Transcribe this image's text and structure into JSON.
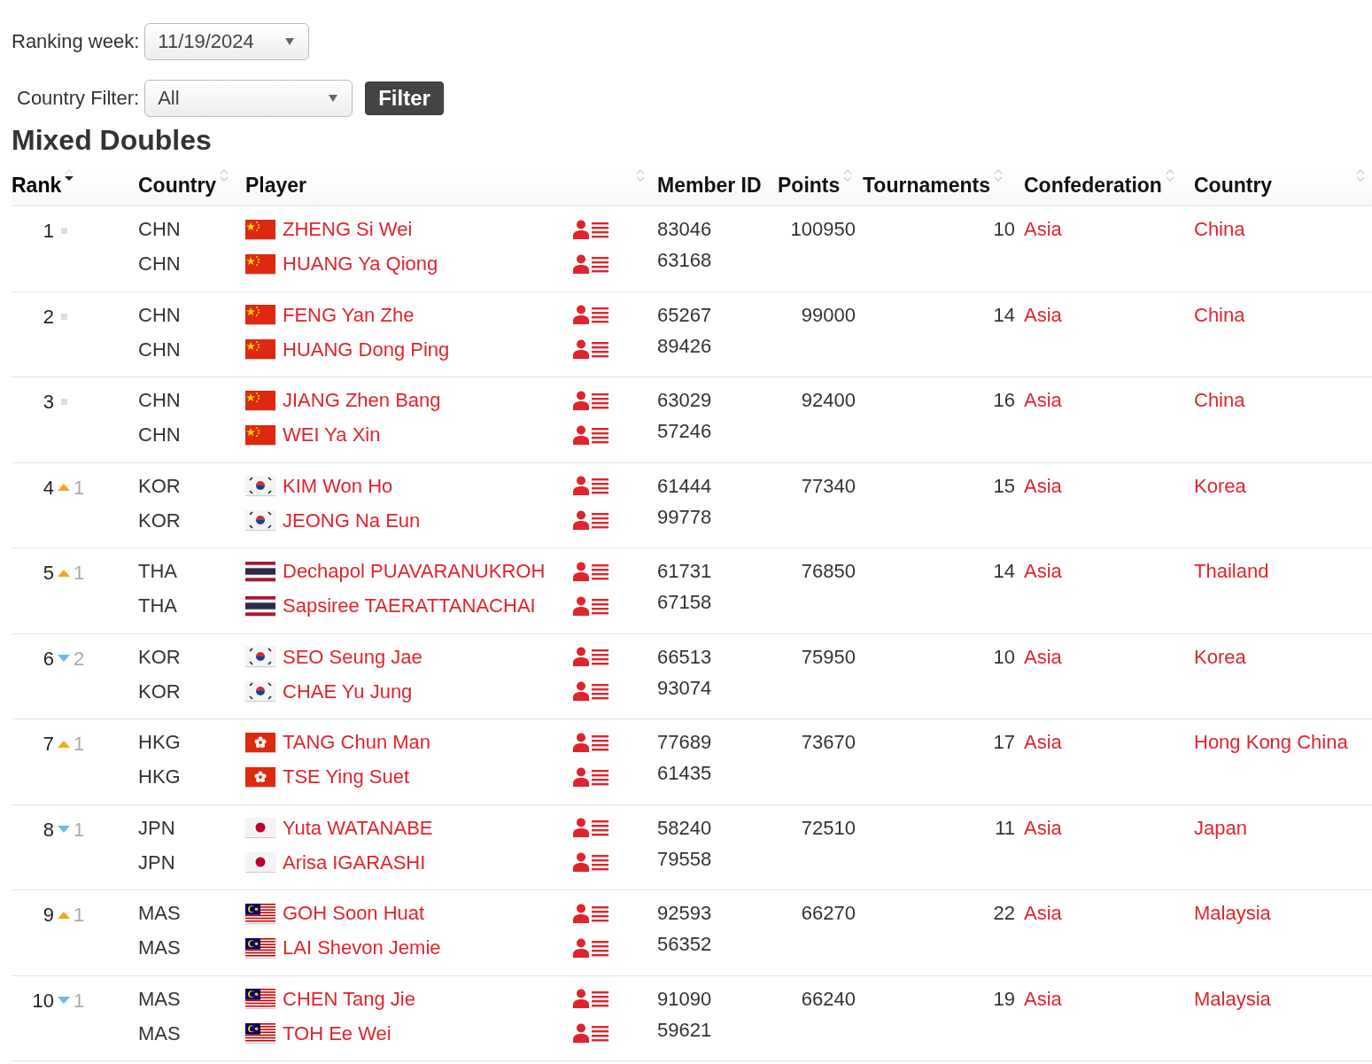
{
  "ranking_week": {
    "label": "Ranking week:",
    "value": "11/19/2024"
  },
  "country_filter": {
    "label": "Country Filter:",
    "value": "All"
  },
  "filter_button": "Filter",
  "heading": "Mixed Doubles",
  "table": {
    "columns": [
      {
        "label": "Rank",
        "sortable": true,
        "sorted": true,
        "kind": "rank"
      },
      {
        "label": "Country",
        "sortable": true,
        "sorted": false,
        "kind": "code"
      },
      {
        "label": "Player",
        "sortable": true,
        "sorted": false,
        "kind": "player"
      },
      {
        "label": "Member ID",
        "sortable": false,
        "sorted": false,
        "kind": "id"
      },
      {
        "label": "Points",
        "sortable": true,
        "sorted": false,
        "kind": "points"
      },
      {
        "label": "Tournaments",
        "sortable": true,
        "sorted": false,
        "kind": "tournaments"
      },
      {
        "label": "Confederation",
        "sortable": true,
        "sorted": false,
        "kind": "confederation"
      },
      {
        "label": "Country",
        "sortable": true,
        "sorted": false,
        "kind": "country"
      }
    ],
    "rows": [
      {
        "rank": "1",
        "kind": "same",
        "players": [
          {
            "code": "CHN",
            "kind": "cn",
            "name": "ZHENG Si Wei",
            "member_id": "83046"
          },
          {
            "code": "CHN",
            "kind": "cn",
            "name": "HUANG Ya Qiong",
            "member_id": "63168"
          }
        ],
        "points": "100950",
        "tournaments": "10",
        "confederation": "Asia",
        "country": "China"
      },
      {
        "rank": "2",
        "kind": "same",
        "players": [
          {
            "code": "CHN",
            "kind": "cn",
            "name": "FENG Yan Zhe",
            "member_id": "65267"
          },
          {
            "code": "CHN",
            "kind": "cn",
            "name": "HUANG Dong Ping",
            "member_id": "89426"
          }
        ],
        "points": "99000",
        "tournaments": "14",
        "confederation": "Asia",
        "country": "China"
      },
      {
        "rank": "3",
        "kind": "same",
        "players": [
          {
            "code": "CHN",
            "kind": "cn",
            "name": "JIANG Zhen Bang",
            "member_id": "63029"
          },
          {
            "code": "CHN",
            "kind": "cn",
            "name": "WEI Ya Xin",
            "member_id": "57246"
          }
        ],
        "points": "92400",
        "tournaments": "16",
        "confederation": "Asia",
        "country": "China"
      },
      {
        "rank": "4",
        "kind": "up",
        "change": "1",
        "players": [
          {
            "code": "KOR",
            "kind": "kr",
            "name": "KIM Won Ho",
            "member_id": "61444"
          },
          {
            "code": "KOR",
            "kind": "kr",
            "name": "JEONG Na Eun",
            "member_id": "99778"
          }
        ],
        "points": "77340",
        "tournaments": "15",
        "confederation": "Asia",
        "country": "Korea"
      },
      {
        "rank": "5",
        "kind": "up",
        "change": "1",
        "players": [
          {
            "code": "THA",
            "kind": "th",
            "name": "Dechapol PUAVARANUKROH",
            "member_id": "61731"
          },
          {
            "code": "THA",
            "kind": "th",
            "name": "Sapsiree TAERATTANACHAI",
            "member_id": "67158"
          }
        ],
        "points": "76850",
        "tournaments": "14",
        "confederation": "Asia",
        "country": "Thailand"
      },
      {
        "rank": "6",
        "kind": "down",
        "change": "2",
        "players": [
          {
            "code": "KOR",
            "kind": "kr",
            "name": "SEO Seung Jae",
            "member_id": "66513"
          },
          {
            "code": "KOR",
            "kind": "kr",
            "name": "CHAE Yu Jung",
            "member_id": "93074"
          }
        ],
        "points": "75950",
        "tournaments": "10",
        "confederation": "Asia",
        "country": "Korea"
      },
      {
        "rank": "7",
        "kind": "up",
        "change": "1",
        "players": [
          {
            "code": "HKG",
            "kind": "hk",
            "name": "TANG Chun Man",
            "member_id": "77689"
          },
          {
            "code": "HKG",
            "kind": "hk",
            "name": "TSE Ying Suet",
            "member_id": "61435"
          }
        ],
        "points": "73670",
        "tournaments": "17",
        "confederation": "Asia",
        "country": "Hong Kong China"
      },
      {
        "rank": "8",
        "kind": "down",
        "change": "1",
        "players": [
          {
            "code": "JPN",
            "kind": "jp",
            "name": "Yuta WATANABE",
            "member_id": "58240"
          },
          {
            "code": "JPN",
            "kind": "jp",
            "name": "Arisa IGARASHI",
            "member_id": "79558"
          }
        ],
        "points": "72510",
        "tournaments": "11",
        "confederation": "Asia",
        "country": "Japan"
      },
      {
        "rank": "9",
        "kind": "up",
        "change": "1",
        "players": [
          {
            "code": "MAS",
            "kind": "my",
            "name": "GOH Soon Huat",
            "member_id": "92593"
          },
          {
            "code": "MAS",
            "kind": "my",
            "name": "LAI Shevon Jemie",
            "member_id": "56352"
          }
        ],
        "points": "66270",
        "tournaments": "22",
        "confederation": "Asia",
        "country": "Malaysia"
      },
      {
        "rank": "10",
        "kind": "down",
        "change": "1",
        "players": [
          {
            "code": "MAS",
            "kind": "my",
            "name": "CHEN Tang Jie",
            "member_id": "91090"
          },
          {
            "code": "MAS",
            "kind": "my",
            "name": "TOH Ee Wei",
            "member_id": "59621"
          }
        ],
        "points": "66240",
        "tournaments": "19",
        "confederation": "Asia",
        "country": "Malaysia"
      }
    ]
  }
}
